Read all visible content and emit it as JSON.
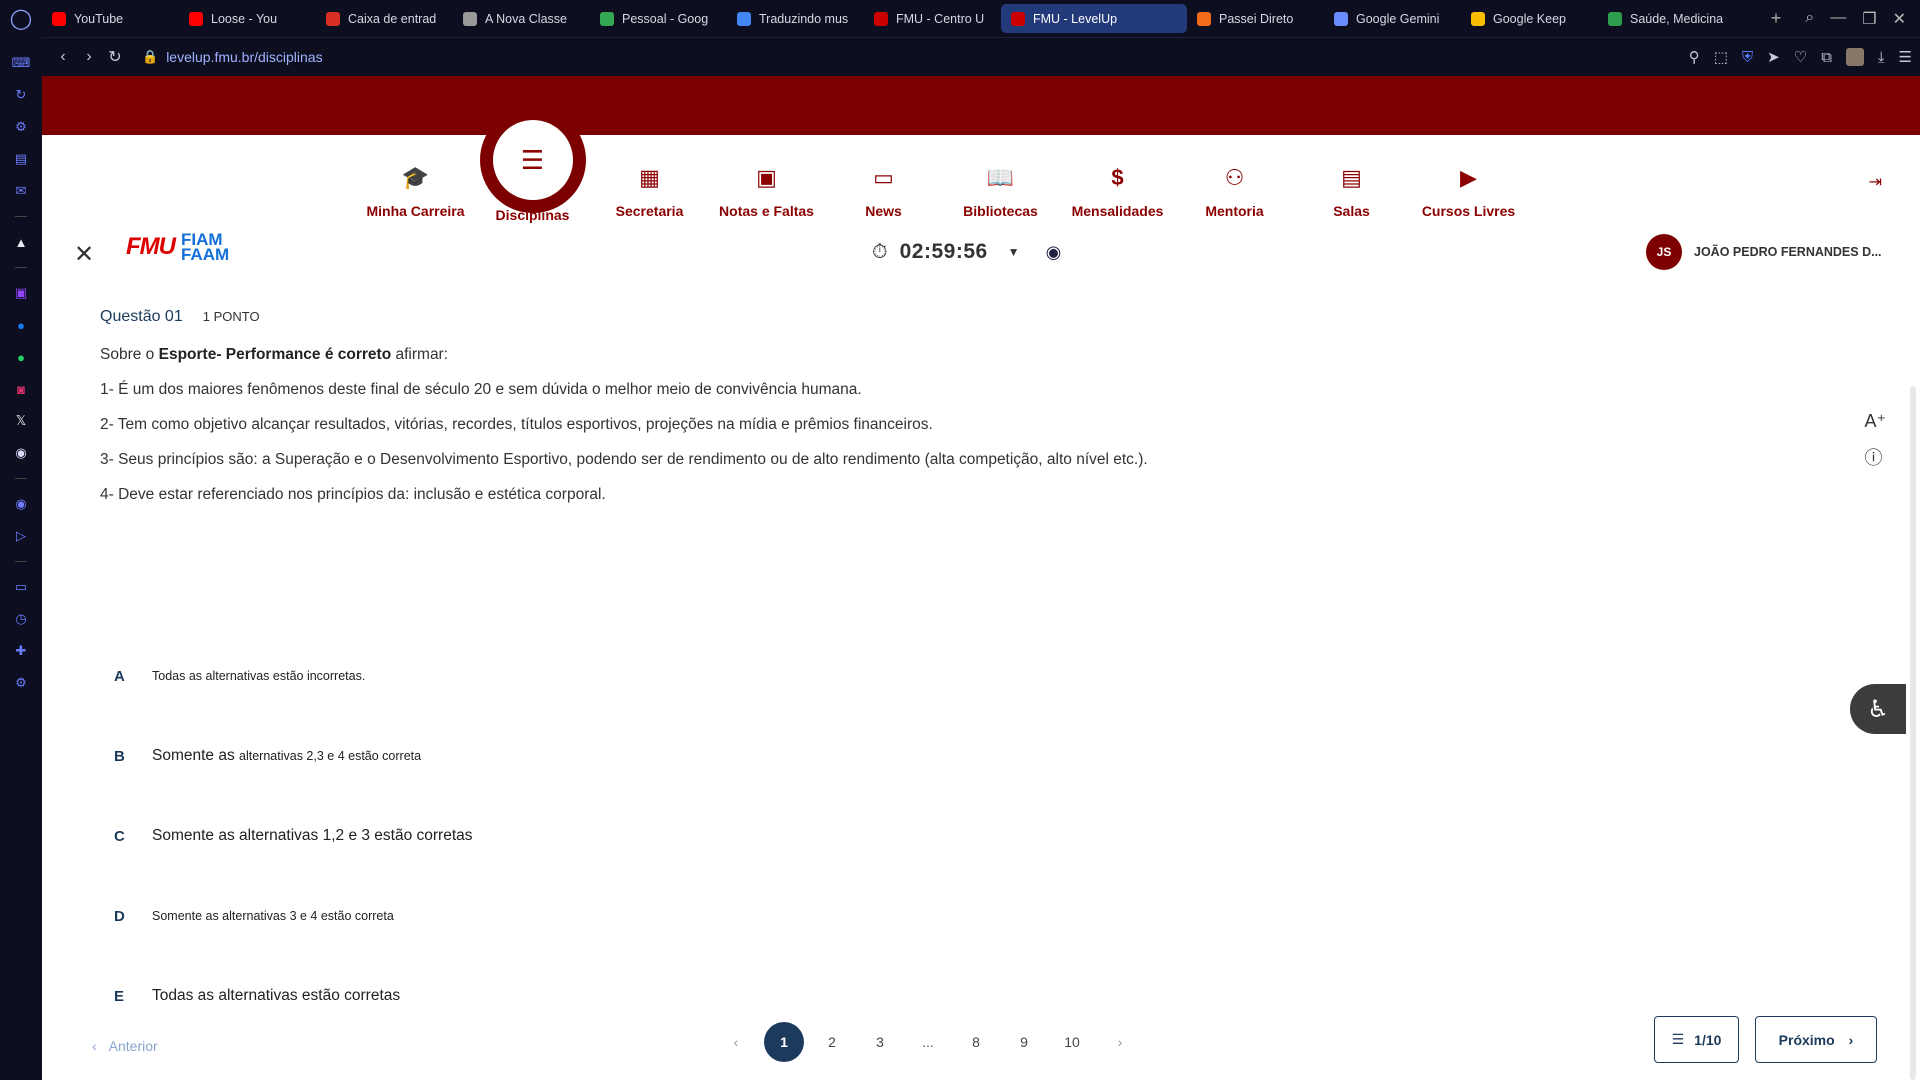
{
  "browser": {
    "tabs": [
      {
        "title": "YouTube",
        "color": "#ff0000"
      },
      {
        "title": "Loose - You",
        "color": "#ff0000"
      },
      {
        "title": "Caixa de entrad",
        "color": "#d93025"
      },
      {
        "title": "A Nova Classe",
        "color": "#999999"
      },
      {
        "title": "Pessoal - Goog",
        "color": "#34a853"
      },
      {
        "title": "Traduzindo mus",
        "color": "#4285f4"
      },
      {
        "title": "FMU - Centro U",
        "color": "#cc0000"
      },
      {
        "title": "FMU - LevelUp",
        "color": "#cc0000"
      },
      {
        "title": "Passei Direto",
        "color": "#f26b1d"
      },
      {
        "title": "Google Gemini",
        "color": "#6b8cff"
      },
      {
        "title": "Google Keep",
        "color": "#fbbc04"
      },
      {
        "title": "Saúde, Medicina",
        "color": "#2e9d4e"
      }
    ],
    "url": "levelup.fmu.br/disciplinas"
  },
  "menu": [
    {
      "label": "Minha Carreira",
      "icon": "graduation-cap-icon"
    },
    {
      "label": "Disciplinas",
      "icon": "document-icon"
    },
    {
      "label": "Secretaria",
      "icon": "building-icon"
    },
    {
      "label": "Notas e Faltas",
      "icon": "grades-icon"
    },
    {
      "label": "News",
      "icon": "monitor-icon"
    },
    {
      "label": "Bibliotecas",
      "icon": "book-icon"
    },
    {
      "label": "Mensalidades",
      "icon": "dollar-icon"
    },
    {
      "label": "Mentoria",
      "icon": "mentor-icon"
    },
    {
      "label": "Salas",
      "icon": "classroom-icon"
    },
    {
      "label": "Cursos Livres",
      "icon": "play-icon"
    }
  ],
  "header": {
    "logo_fmu": "FMU",
    "logo_fiam": "FIAM",
    "logo_faam": "FAAM",
    "timer": "02:59:56",
    "user_initials": "JS",
    "user_name": "JOÃO PEDRO FERNANDES D..."
  },
  "question": {
    "number": "Questão 01",
    "points": "1 PONTO",
    "intro_pre": "Sobre o ",
    "intro_bold": "Esporte- Performance é correto",
    "intro_post": " afirmar:",
    "statements": [
      "1- É um dos maiores fenômenos deste final de século 20 e sem dúvida o melhor meio de convivência humana.",
      "2- Tem como objetivo alcançar resultados, vitórias, recordes, títulos esportivos, projeções na mídia e prêmios financeiros.",
      "3- Seus princípios são: a Superação e o Desenvolvimento Esportivo, podendo ser de rendimento ou de alto rendimento (alta competição, alto nível etc.).",
      "4- Deve estar referenciado nos princípios da: inclusão e  estética  corporal."
    ]
  },
  "options": {
    "a_letter": "A",
    "a_text": "Todas as alternativas estão incorretas.",
    "b_letter": "B",
    "b_text_1": "Somente as ",
    "b_text_2": "alternativas 2,3 e 4 estão correta",
    "c_letter": "C",
    "c_text": "Somente as  alternativas 1,2 e 3 estão corretas",
    "d_letter": "D",
    "d_text": "Somente as  alternativas 3 e 4 estão correta",
    "e_letter": "E",
    "e_text": "Todas as alternativas estão corretas"
  },
  "footer": {
    "prev_label": "Anterior",
    "pages": [
      "1",
      "2",
      "3",
      "...",
      "8",
      "9",
      "10"
    ],
    "current_page": "1",
    "count_label": "1/10",
    "next_label": "Próximo"
  }
}
